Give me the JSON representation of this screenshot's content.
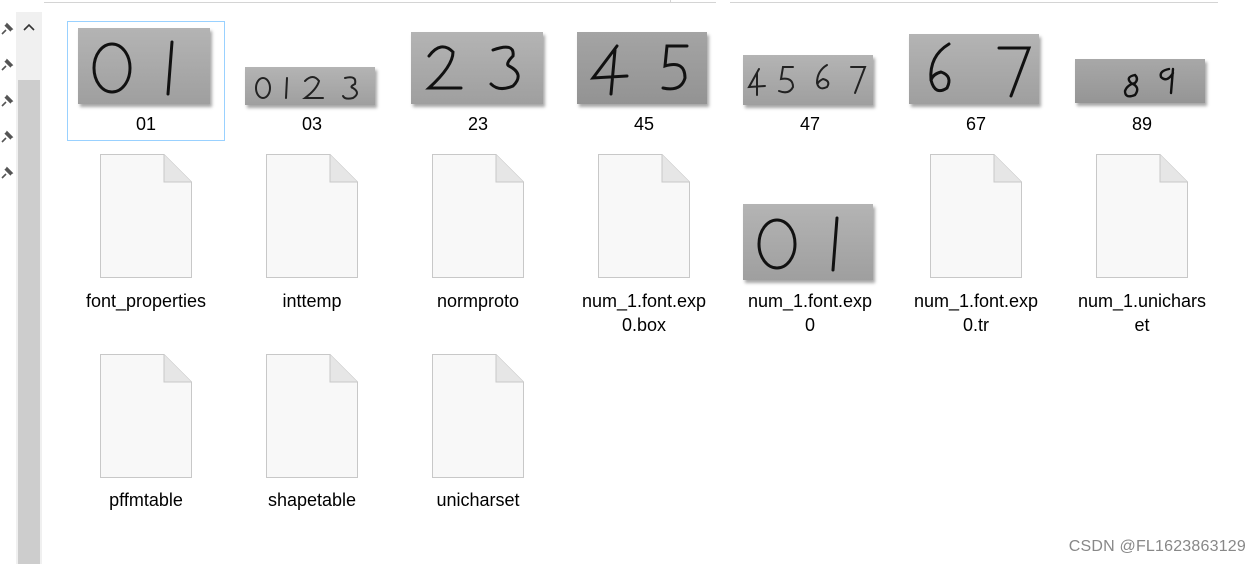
{
  "files_row1": [
    {
      "name": "01"
    },
    {
      "name": "03"
    },
    {
      "name": "23"
    },
    {
      "name": "45"
    },
    {
      "name": "47"
    },
    {
      "name": "67"
    },
    {
      "name": "89"
    }
  ],
  "files_row2": [
    {
      "line1": "font_properties",
      "line2": ""
    },
    {
      "line1": "inttemp",
      "line2": ""
    },
    {
      "line1": "normproto",
      "line2": ""
    },
    {
      "line1": "num_1.font.exp",
      "line2": "0.box"
    },
    {
      "line1": "num_1.font.exp",
      "line2": "0"
    },
    {
      "line1": "num_1.font.exp",
      "line2": "0.tr"
    },
    {
      "line1": "num_1.unichars",
      "line2": "et"
    }
  ],
  "files_row3": [
    {
      "name": "pffmtable"
    },
    {
      "name": "shapetable"
    },
    {
      "name": "unicharset"
    }
  ],
  "watermark": "CSDN @FL1623863129",
  "colors": {
    "selection_border": "#99d1ff",
    "scrollbar_track": "#f0f0f0",
    "scrollbar_thumb": "#cdcdcd"
  }
}
